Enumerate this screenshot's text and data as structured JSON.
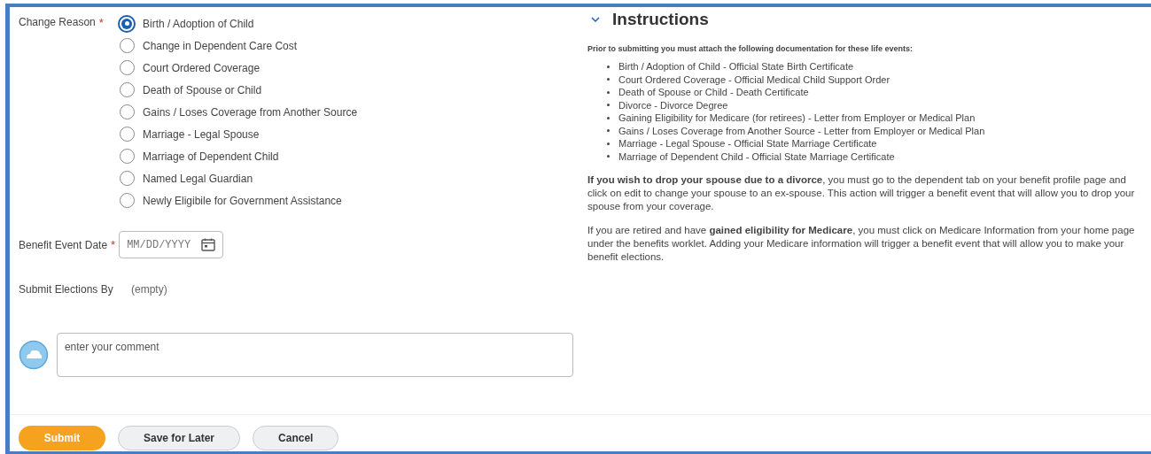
{
  "change_reason": {
    "label": "Change Reason",
    "required_mark": "*",
    "options": [
      {
        "label": "Birth / Adoption of Child",
        "selected": true
      },
      {
        "label": "Change in Dependent Care Cost",
        "selected": false
      },
      {
        "label": "Court Ordered Coverage",
        "selected": false
      },
      {
        "label": "Death of Spouse or Child",
        "selected": false
      },
      {
        "label": "Gains / Loses Coverage from Another Source",
        "selected": false
      },
      {
        "label": "Marriage - Legal Spouse",
        "selected": false
      },
      {
        "label": "Marriage of Dependent Child",
        "selected": false
      },
      {
        "label": "Named Legal Guardian",
        "selected": false
      },
      {
        "label": "Newly Eligibile for Government Assistance",
        "selected": false
      }
    ]
  },
  "benefit_event_date": {
    "label": "Benefit Event Date",
    "required_mark": "*",
    "placeholder": "MM/DD/YYYY"
  },
  "submit_elections_by": {
    "label": "Submit Elections By",
    "value": "(empty)"
  },
  "comment": {
    "placeholder": "enter your comment"
  },
  "instructions": {
    "title": "Instructions",
    "expanded": true,
    "intro": "Prior to submitting you must attach the following documentation for these life events:",
    "items": [
      "Birth / Adoption of Child - Official State Birth Certificate",
      "Court Ordered Coverage - Official Medical Child Support Order",
      "Death of Spouse or Child - Death Certificate",
      "Divorce - Divorce Degree",
      "Gaining Eligibility for Medicare (for retirees) - Letter from Employer or Medical Plan",
      "Gains / Loses Coverage from Another Source - Letter from Employer or Medical Plan",
      "Marriage - Legal Spouse - Official State Marriage Certificate",
      "Marriage of Dependent Child - Official State Marriage Certificate"
    ],
    "paragraphs": [
      "**If you wish to drop your spouse due to a divorce**, you must go to the dependent tab on your benefit profile page and click on edit to change your spouse to an ex-spouse. This action will trigger a benefit event that will allow you to drop your spouse from your coverage.",
      "If you are retired and have **gained eligibility for Medicare**, you must click on Medicare Information from your home page under the benefits worklet. Adding your Medicare information will trigger a benefit event that will allow you to make your benefit elections."
    ]
  },
  "buttons": [
    {
      "label": "Submit",
      "kind": "primary"
    },
    {
      "label": "Save for Later",
      "kind": "secondary"
    },
    {
      "label": "Cancel",
      "kind": "secondary"
    }
  ]
}
